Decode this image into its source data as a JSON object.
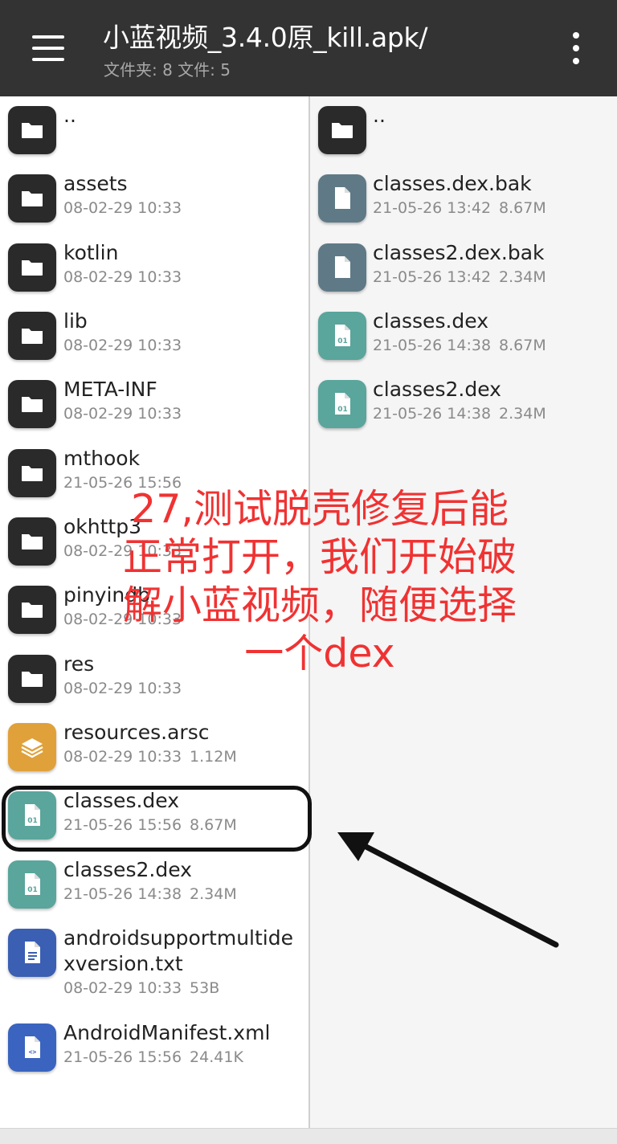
{
  "toolbar": {
    "title": "小蓝视频_3.4.0原_kill.apk/",
    "subtitle": "文件夹: 8  文件: 5",
    "menu_icon": "hamburger-menu-icon",
    "more_icon": "more-vertical-icon"
  },
  "colors": {
    "toolbar_bg": "#333333",
    "folder_icon": "#2a2a2a",
    "bak_icon": "#5f7a86",
    "dex_icon": "#5aa59c",
    "arsc_icon": "#e0a13a",
    "txt_icon": "#3a5fb3",
    "xml_icon": "#3a64bf",
    "annotation": "#f03232"
  },
  "left_items": [
    {
      "icon": "folder-icon",
      "name": "..",
      "date": "",
      "size": ""
    },
    {
      "icon": "folder-icon",
      "name": "assets",
      "date": "08-02-29 10:33",
      "size": ""
    },
    {
      "icon": "folder-icon",
      "name": "kotlin",
      "date": "08-02-29 10:33",
      "size": ""
    },
    {
      "icon": "folder-icon",
      "name": "lib",
      "date": "08-02-29 10:33",
      "size": ""
    },
    {
      "icon": "folder-icon",
      "name": "META-INF",
      "date": "08-02-29 10:33",
      "size": ""
    },
    {
      "icon": "folder-icon",
      "name": "mthook",
      "date": "21-05-26 15:56",
      "size": ""
    },
    {
      "icon": "folder-icon",
      "name": "okhttp3",
      "date": "08-02-29 10:33",
      "size": ""
    },
    {
      "icon": "folder-icon",
      "name": "pinyindb",
      "date": "08-02-29 10:33",
      "size": ""
    },
    {
      "icon": "folder-icon",
      "name": "res",
      "date": "08-02-29 10:33",
      "size": ""
    },
    {
      "icon": "arsc-file-icon",
      "name": "resources.arsc",
      "date": "08-02-29 10:33",
      "size": "1.12M"
    },
    {
      "icon": "dex-file-icon",
      "name": "classes.dex",
      "date": "21-05-26 15:56",
      "size": "8.67M"
    },
    {
      "icon": "dex-file-icon",
      "name": "classes2.dex",
      "date": "21-05-26 14:38",
      "size": "2.34M"
    },
    {
      "icon": "text-file-icon",
      "name": "androidsupportmultide",
      "name2": "xversion.txt",
      "date": "08-02-29 10:33",
      "size": "53B"
    },
    {
      "icon": "xml-file-icon",
      "name": "AndroidManifest.xml",
      "date": "21-05-26 15:56",
      "size": "24.41K"
    }
  ],
  "right_items": [
    {
      "icon": "folder-icon",
      "name": "..",
      "date": "",
      "size": ""
    },
    {
      "icon": "backup-file-icon",
      "name": "classes.dex.bak",
      "date": "21-05-26 13:42",
      "size": "8.67M"
    },
    {
      "icon": "backup-file-icon",
      "name": "classes2.dex.bak",
      "date": "21-05-26 13:42",
      "size": "2.34M"
    },
    {
      "icon": "dex-file-icon",
      "name": "classes.dex",
      "date": "21-05-26 14:38",
      "size": "8.67M"
    },
    {
      "icon": "dex-file-icon",
      "name": "classes2.dex",
      "date": "21-05-26 14:38",
      "size": "2.34M"
    }
  ],
  "annotation": {
    "lines": [
      "27,测试脱壳修复后能",
      "正常打开，我们开始破",
      "解小蓝视频，随便选择",
      "一个dex"
    ]
  }
}
